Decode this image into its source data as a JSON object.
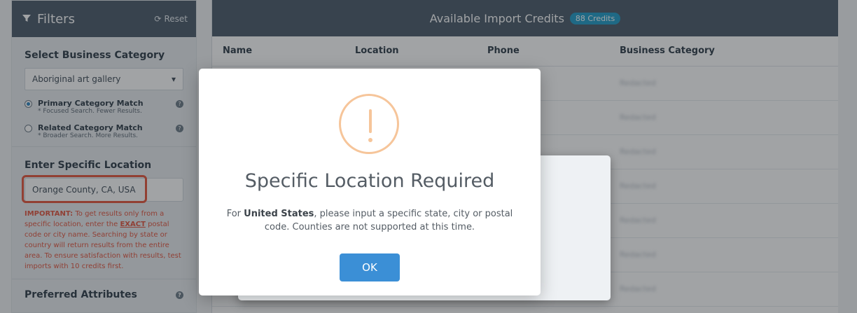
{
  "sidebar": {
    "title": "Filters",
    "reset_label": "Reset",
    "category": {
      "heading": "Select Business Category",
      "selected": "Aboriginal art gallery",
      "options": [
        {
          "label": "Primary Category Match",
          "note": "* Focused Search. Fewer Results.",
          "checked": true
        },
        {
          "label": "Related Category Match",
          "note": "* Broader Search. More Results.",
          "checked": false
        }
      ]
    },
    "location": {
      "heading": "Enter Specific Location",
      "value": "Orange County, CA, USA",
      "important_lead": "IMPORTANT:",
      "important_part1": " To get results only from a specific location, enter the ",
      "important_exact": "EXACT",
      "important_part2": " postal code or city name. Searching by state or country will return results from the entire area. To ensure satisfaction with results, test imports with 10 credits first."
    },
    "preferred": {
      "heading": "Preferred Attributes"
    }
  },
  "main": {
    "header_title": "Available Import Credits",
    "credits_badge": "88 Credits",
    "columns": [
      "Name",
      "Location",
      "Phone",
      "Business Category"
    ],
    "rows": [
      {
        "category": "Redacted"
      },
      {
        "category": "Redacted"
      },
      {
        "category": "Redacted"
      },
      {
        "category": "Redacted"
      },
      {
        "category": "Redacted"
      },
      {
        "category": "Redacted"
      },
      {
        "category": "Redacted"
      }
    ]
  },
  "modal": {
    "title": "Specific Location Required",
    "text_prefix": "For ",
    "text_country": "United States",
    "text_suffix": ", please input a specific state, city or postal code. Counties are not supported at this time.",
    "ok_label": "OK",
    "icon": "exclamation-icon",
    "icon_color": "#f6c59a",
    "button_color": "#3b8fd6"
  }
}
